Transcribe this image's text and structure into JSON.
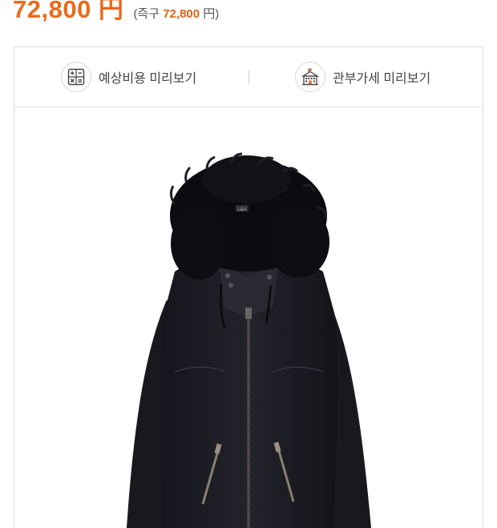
{
  "price": {
    "main": "72,800 円",
    "sub_prefix": "(즉구",
    "sub_value": "72,800",
    "sub_suffix": "円)"
  },
  "tools": {
    "estimate": {
      "label": "예상비용 미리보기",
      "icon": "calculator-icon"
    },
    "customs": {
      "label": "관부가세 미리보기",
      "icon": "customs-building-icon"
    }
  },
  "product": {
    "image": "black-fur-hood-jacket",
    "label_text": "L&A"
  },
  "colors": {
    "price": "#ea6a1c",
    "border": "#dcdcdc"
  }
}
